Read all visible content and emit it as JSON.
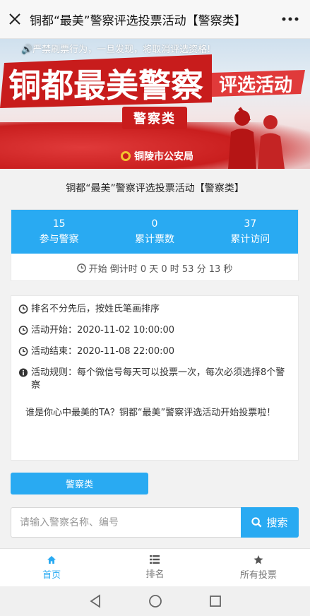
{
  "topbar": {
    "title": "铜都“最美”警察评选投票活动【警察类】"
  },
  "banner": {
    "notice": "🔊严禁刷票行为，一旦发现，将取消评选资格!",
    "headline_main": "铜都最美警察",
    "headline_sub": "评选活动",
    "category_badge": "警察类",
    "org": "铜陵市公安局",
    "colors": {
      "red": "#c81c1c"
    }
  },
  "activity_title": "铜都“最美”警察评选投票活动【警察类】",
  "stats": {
    "items": [
      {
        "value": "15",
        "label": "参与警察"
      },
      {
        "value": "0",
        "label": "累计票数"
      },
      {
        "value": "37",
        "label": "累计访问"
      }
    ],
    "countdown": "开始 倒计时 0 天 0 时 53 分 13 秒"
  },
  "info": {
    "lines": [
      "排名不分先后，按姓氏笔画排序",
      "活动开始：2020-11-02 10:00:00",
      "活动结束：2020-11-08 22:00:00",
      "活动规则：每个微信号每天可以投票一次，每次必须选择8个警察"
    ],
    "intro": "谁是你心中最美的TA？铜都“最美”警察评选活动开始投票啦！"
  },
  "category_button": "警察类",
  "search": {
    "placeholder": "请输入警察名称、编号",
    "button": "搜索"
  },
  "bottom_nav": [
    {
      "label": "首页",
      "icon": "home-icon",
      "active": true
    },
    {
      "label": "排名",
      "icon": "list-icon",
      "active": false
    },
    {
      "label": "所有投票",
      "icon": "star-icon",
      "active": false
    }
  ],
  "colors": {
    "accent": "#29aaf2"
  }
}
